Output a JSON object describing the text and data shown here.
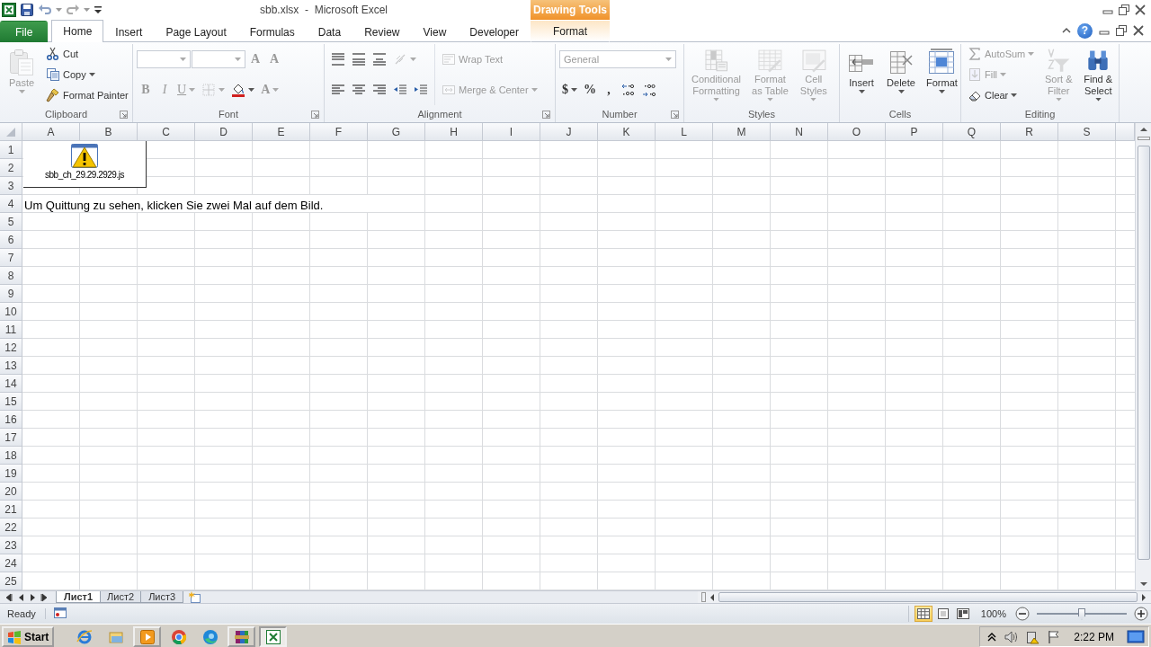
{
  "title_bar": {
    "title": "sbb.xlsx  -  Microsoft Excel",
    "contextual_group": "Drawing Tools"
  },
  "ribbon_tabs": [
    {
      "label": "File",
      "kind": "file",
      "selected": false
    },
    {
      "label": "Home",
      "kind": "normal",
      "selected": true
    },
    {
      "label": "Insert",
      "kind": "normal",
      "selected": false
    },
    {
      "label": "Page Layout",
      "kind": "normal",
      "selected": false
    },
    {
      "label": "Formulas",
      "kind": "normal",
      "selected": false
    },
    {
      "label": "Data",
      "kind": "normal",
      "selected": false
    },
    {
      "label": "Review",
      "kind": "normal",
      "selected": false
    },
    {
      "label": "View",
      "kind": "normal",
      "selected": false
    },
    {
      "label": "Developer",
      "kind": "normal",
      "selected": false
    },
    {
      "label": "Format",
      "kind": "contextual",
      "selected": false
    }
  ],
  "help_button": "?",
  "ribbon_groups": [
    {
      "label": "Clipboard",
      "launcher": true,
      "columns": [
        [
          [
            {
              "kind": "large",
              "label": "Paste",
              "disabled": true,
              "dropdown": true
            }
          ]
        ],
        [
          [
            {
              "kind": "small",
              "label": "Cut",
              "disabled": false,
              "dropdown": false
            }
          ],
          [
            {
              "kind": "small",
              "label": "Copy",
              "disabled": false,
              "dropdown": true
            }
          ],
          [
            {
              "kind": "small",
              "label": "Format Painter",
              "disabled": false,
              "dropdown": false
            }
          ]
        ]
      ]
    },
    {
      "label": "Font",
      "launcher": true,
      "columns": [
        [
          [
            {
              "kind": "combo",
              "disabled": true,
              "dropdown": true
            },
            {
              "kind": "combo",
              "disabled": true,
              "dropdown": true
            },
            {
              "kind": "glyph",
              "label": "A",
              "disabled": true,
              "dropdown": false
            },
            {
              "kind": "glyph",
              "label": "A",
              "disabled": true,
              "dropdown": false
            }
          ],
          [
            {
              "kind": "bold",
              "label": "B",
              "disabled": true,
              "dropdown": false
            },
            {
              "kind": "italic",
              "label": "I",
              "disabled": true,
              "dropdown": false
            },
            {
              "kind": "underline",
              "label": "U",
              "disabled": true,
              "dropdown": true
            },
            {
              "kind": "icon",
              "disabled": true,
              "dropdown": true
            },
            {
              "kind": "icon",
              "disabled": false,
              "dropdown": true
            },
            {
              "kind": "glyph",
              "label": "A",
              "disabled": true,
              "dropdown": true
            }
          ]
        ]
      ]
    },
    {
      "label": "Alignment",
      "launcher": true,
      "columns": [
        [
          [
            {
              "kind": "icon",
              "disabled": false,
              "dropdown": false
            },
            {
              "kind": "icon",
              "disabled": false,
              "dropdown": false
            },
            {
              "kind": "icon",
              "disabled": false,
              "dropdown": false
            },
            {
              "kind": "icon",
              "disabled": true,
              "dropdown": true
            }
          ],
          [
            {
              "kind": "icon",
              "disabled": false,
              "dropdown": false
            },
            {
              "kind": "icon",
              "disabled": false,
              "dropdown": false
            },
            {
              "kind": "icon",
              "disabled": false,
              "dropdown": false
            },
            {
              "kind": "icon",
              "disabled": false,
              "dropdown": false
            },
            {
              "kind": "icon",
              "disabled": false,
              "dropdown": false
            }
          ]
        ],
        [
          [
            {
              "kind": "small",
              "label": "Wrap Text",
              "disabled": true,
              "dropdown": false
            }
          ],
          [
            {
              "kind": "small",
              "label": "Merge & Center",
              "disabled": true,
              "dropdown": true
            }
          ]
        ]
      ]
    },
    {
      "label": "Number",
      "launcher": true,
      "columns": [
        [
          [
            {
              "kind": "combo",
              "value": "General",
              "disabled": true,
              "dropdown": true
            }
          ],
          [
            {
              "kind": "glyph",
              "label": "$",
              "disabled": false,
              "dropdown": true
            },
            {
              "kind": "glyph",
              "label": "%",
              "disabled": false,
              "dropdown": false
            },
            {
              "kind": "glyph",
              "label": ",",
              "disabled": false,
              "dropdown": false
            },
            {
              "kind": "icon",
              "disabled": false,
              "dropdown": false
            },
            {
              "kind": "icon",
              "disabled": false,
              "dropdown": false
            }
          ]
        ]
      ]
    },
    {
      "label": "Styles",
      "launcher": false,
      "columns": [
        [
          [
            {
              "kind": "large",
              "label": "Conditional\nFormatting",
              "disabled": true,
              "dropdown": true
            }
          ]
        ],
        [
          [
            {
              "kind": "large",
              "label": "Format\nas Table",
              "disabled": true,
              "dropdown": true
            }
          ]
        ],
        [
          [
            {
              "kind": "large",
              "label": "Cell\nStyles",
              "disabled": true,
              "dropdown": true
            }
          ]
        ]
      ]
    },
    {
      "label": "Cells",
      "launcher": false,
      "columns": [
        [
          [
            {
              "kind": "large",
              "label": "Insert",
              "disabled": false,
              "dropdown": true
            }
          ]
        ],
        [
          [
            {
              "kind": "large",
              "label": "Delete",
              "disabled": false,
              "dropdown": true
            }
          ]
        ],
        [
          [
            {
              "kind": "large",
              "label": "Format",
              "disabled": false,
              "dropdown": true
            }
          ]
        ]
      ]
    },
    {
      "label": "Editing",
      "launcher": false,
      "columns": [
        [
          [
            {
              "kind": "small",
              "label": "AutoSum",
              "disabled": true,
              "dropdown": true
            }
          ],
          [
            {
              "kind": "small",
              "label": "Fill",
              "disabled": true,
              "dropdown": true
            }
          ],
          [
            {
              "kind": "small",
              "label": "Clear",
              "disabled": false,
              "dropdown": true
            }
          ]
        ],
        [
          [
            {
              "kind": "large",
              "label": "Sort &\nFilter",
              "disabled": true,
              "dropdown": true
            }
          ]
        ],
        [
          [
            {
              "kind": "large",
              "label": "Find &\nSelect",
              "disabled": false,
              "dropdown": true
            }
          ]
        ]
      ]
    }
  ],
  "sheet": {
    "columns": [
      "A",
      "B",
      "C",
      "D",
      "E",
      "F",
      "G",
      "H",
      "I",
      "J",
      "K",
      "L",
      "M",
      "N",
      "O",
      "P",
      "Q",
      "R",
      "S"
    ],
    "rows": [
      {
        "number": "1"
      },
      {
        "number": "2"
      },
      {
        "number": "3"
      },
      {
        "number": "4",
        "text": "Um Quittung zu sehen, klicken Sie zwei Mal auf dem Bild."
      },
      {
        "number": "5"
      },
      {
        "number": "6"
      },
      {
        "number": "7"
      },
      {
        "number": "8"
      },
      {
        "number": "9"
      },
      {
        "number": "10"
      },
      {
        "number": "11"
      },
      {
        "number": "12"
      },
      {
        "number": "13"
      },
      {
        "number": "14"
      },
      {
        "number": "15"
      },
      {
        "number": "16"
      },
      {
        "number": "17"
      },
      {
        "number": "18"
      },
      {
        "number": "19"
      },
      {
        "number": "20"
      },
      {
        "number": "21"
      },
      {
        "number": "22"
      },
      {
        "number": "23"
      },
      {
        "number": "24"
      },
      {
        "number": "25"
      }
    ],
    "embedded_object": {
      "caption": "sbb_ch_29.29.2929.js"
    }
  },
  "sheet_tabs": [
    {
      "label": "Лист1",
      "selected": true
    },
    {
      "label": "Лист2",
      "selected": false
    },
    {
      "label": "Лист3",
      "selected": false
    }
  ],
  "status_bar": {
    "status": "Ready",
    "views": [
      {
        "selected": true
      },
      {
        "selected": false
      },
      {
        "selected": false
      }
    ],
    "zoom": "100%",
    "zoom_slider": {
      "level": 0.5
    }
  },
  "taskbar": {
    "start": "Start",
    "apps": [
      {
        "running": false,
        "selected": false
      },
      {
        "running": false,
        "selected": false
      },
      {
        "running": true,
        "selected": false
      },
      {
        "running": false,
        "selected": false
      },
      {
        "running": false,
        "selected": false
      },
      {
        "running": true,
        "selected": false
      },
      {
        "running": true,
        "selected": true
      }
    ],
    "clock": "2:22 PM"
  }
}
